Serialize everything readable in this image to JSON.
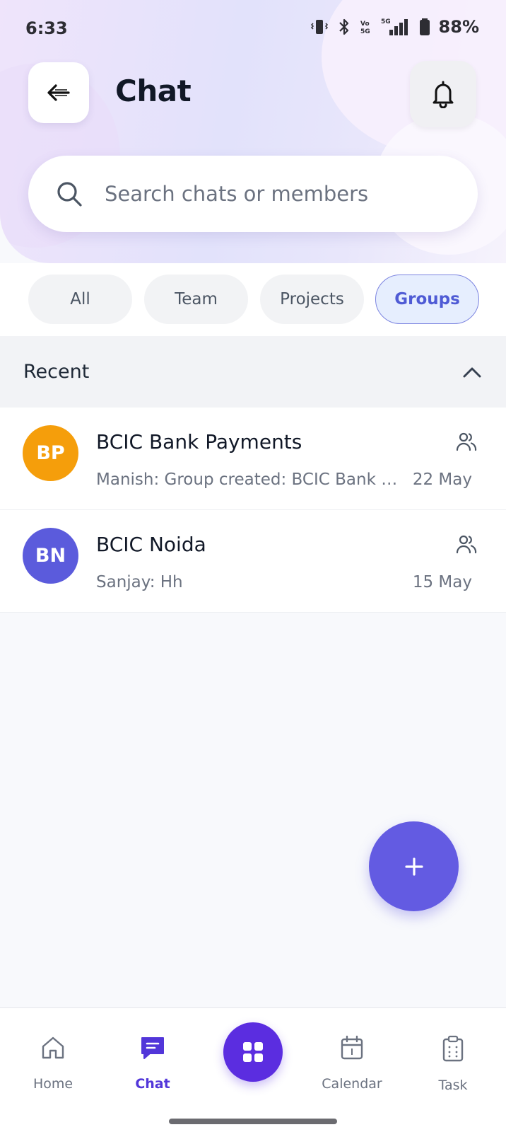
{
  "status_bar": {
    "time": "6:33",
    "battery": "88%",
    "network": "5G"
  },
  "header": {
    "title": "Chat"
  },
  "search": {
    "placeholder": "Search chats or members"
  },
  "filters": [
    {
      "label": "All",
      "active": false
    },
    {
      "label": "Team",
      "active": false
    },
    {
      "label": "Projects",
      "active": false
    },
    {
      "label": "Groups",
      "active": true
    }
  ],
  "section": {
    "title": "Recent"
  },
  "chats": [
    {
      "initials": "BP",
      "name": "BCIC Bank Payments",
      "preview": "Manish: Group created: BCIC Bank P...",
      "date": "22 May",
      "avatar_color": "#f59e0b"
    },
    {
      "initials": "BN",
      "name": "BCIC Noida",
      "preview": "Sanjay: Hh",
      "date": "15 May",
      "avatar_color": "#5b5bdc"
    }
  ],
  "bottom_nav": [
    {
      "label": "Home",
      "icon": "home-icon",
      "active": false
    },
    {
      "label": "Chat",
      "icon": "chat-icon",
      "active": true
    },
    {
      "label": "Calendar",
      "icon": "calendar-icon",
      "active": false
    },
    {
      "label": "Task",
      "icon": "clipboard-icon",
      "active": false
    }
  ],
  "colors": {
    "accent": "#635be2",
    "nav_active": "#5236d9",
    "center_button": "#5b2de0"
  }
}
